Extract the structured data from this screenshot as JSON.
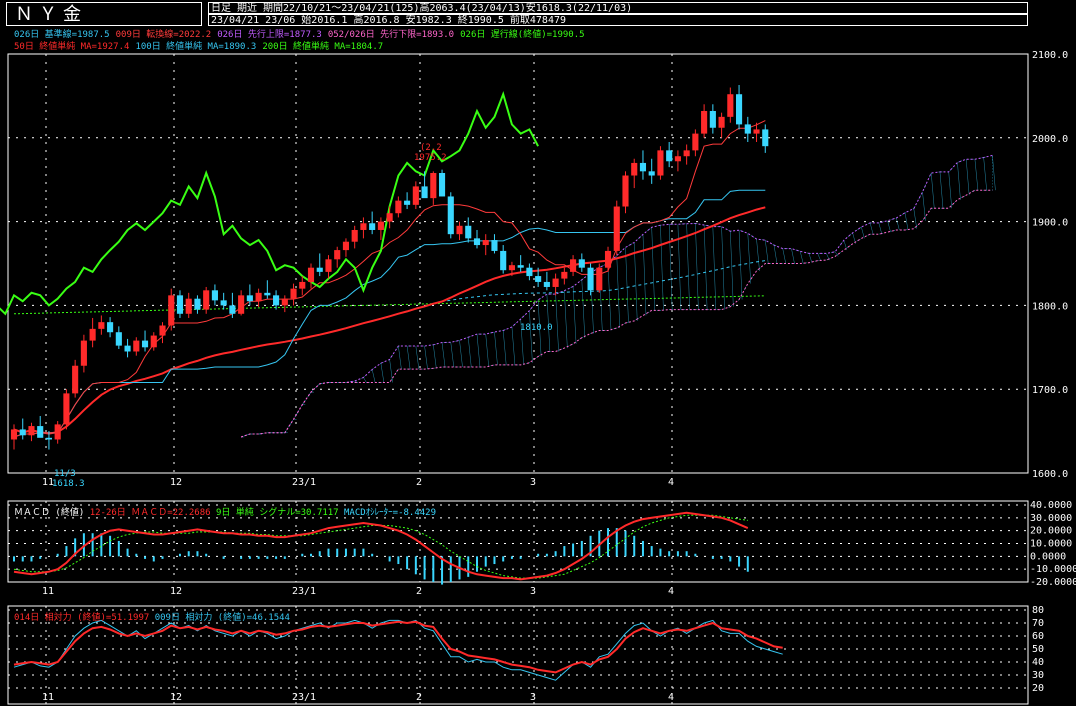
{
  "header": {
    "title": "ＮＹ金",
    "line1": "日足 期近 期間22/10/21〜23/04/21(125)高2063.4(23/04/13)安1618.3(22/11/03)",
    "line2": "23/04/21 23/06 始2016.1 高2016.8 安1982.3 終1990.5 前取478479"
  },
  "legend": {
    "row1": [
      {
        "text": "026日 基準線=1987.5",
        "color": "#36c5f0"
      },
      {
        "text": "009日 転換線=2022.2",
        "color": "#ff3b3b"
      },
      {
        "text": "026日 先行上限=1877.3",
        "color": "#c15cff"
      },
      {
        "text": "052/026日 先行下限=1893.0",
        "color": "#ff66cc"
      },
      {
        "text": "026日 遅行線(終値)=1990.5",
        "color": "#39ff14"
      }
    ],
    "row2": [
      {
        "text": "50日 終値単純 MA=1927.4",
        "color": "#ff2a2a"
      },
      {
        "text": "100日 終値単純 MA=1890.3",
        "color": "#36c5f0"
      },
      {
        "text": "200日 終値単純 MA=1804.7",
        "color": "#39ff14"
      }
    ]
  },
  "annotations": {
    "high_label": "(2.2",
    "high_value": "1975.2",
    "low_date": "11/3",
    "low_value": "1618.3",
    "mid_low": "1810.0"
  },
  "macd_legend": {
    "title": "ＭＡＣＤ (終値)",
    "macd": "12-26日 ＭＡＣＤ=22.2686",
    "signal": "9日 単純 シグナル=30.7117",
    "osc": "MACDｵｼﾚｰﾀｰ=-8.4429"
  },
  "rsi_legend": {
    "rsi14": "014日 相対力 (終値)=51.1997",
    "rsi9": "009日 相対力 (終値)=46.1544"
  },
  "colors": {
    "up_candle": "#ff2a2a",
    "down_candle": "#3ad7ff",
    "tenkan": "#ff3b3b",
    "kijun": "#36c5f0",
    "chikou": "#39ff14",
    "ma50": "#ff2a2a",
    "ma100": "#36c5f0",
    "ma200": "#39ff14",
    "span_a": "#c15cff",
    "span_b": "#ff66cc",
    "macd": "#ff2a2a",
    "signal": "#39ff14",
    "rsi14": "#ff2a2a",
    "rsi9": "#36c5f0"
  },
  "chart_data": [
    {
      "type": "candlestick",
      "title": "ＮＹ金",
      "y_ticks": [
        "2100.0",
        "2000.0",
        "1900.0",
        "1800.0",
        "1700.0",
        "1600.0"
      ],
      "ylim": [
        1600,
        2100
      ],
      "x_tick_labels": [
        "11",
        "12",
        "23/1",
        "2",
        "3",
        "4"
      ],
      "candles": [
        [
          1640,
          1658,
          1628,
          1652
        ],
        [
          1652,
          1665,
          1640,
          1645
        ],
        [
          1645,
          1660,
          1638,
          1656
        ],
        [
          1656,
          1668,
          1648,
          1642
        ],
        [
          1642,
          1650,
          1628,
          1640
        ],
        [
          1640,
          1662,
          1635,
          1658
        ],
        [
          1658,
          1700,
          1652,
          1695
        ],
        [
          1695,
          1735,
          1690,
          1728
        ],
        [
          1728,
          1765,
          1720,
          1758
        ],
        [
          1758,
          1785,
          1750,
          1772
        ],
        [
          1772,
          1788,
          1765,
          1780
        ],
        [
          1780,
          1786,
          1762,
          1768
        ],
        [
          1768,
          1775,
          1748,
          1752
        ],
        [
          1752,
          1760,
          1738,
          1745
        ],
        [
          1745,
          1762,
          1740,
          1758
        ],
        [
          1758,
          1770,
          1745,
          1750
        ],
        [
          1750,
          1768,
          1746,
          1764
        ],
        [
          1764,
          1780,
          1755,
          1776
        ],
        [
          1776,
          1820,
          1770,
          1812
        ],
        [
          1812,
          1818,
          1785,
          1790
        ],
        [
          1790,
          1815,
          1785,
          1808
        ],
        [
          1808,
          1812,
          1790,
          1795
        ],
        [
          1795,
          1822,
          1790,
          1818
        ],
        [
          1818,
          1825,
          1800,
          1806
        ],
        [
          1806,
          1815,
          1795,
          1800
        ],
        [
          1800,
          1815,
          1785,
          1790
        ],
        [
          1790,
          1818,
          1788,
          1812
        ],
        [
          1812,
          1825,
          1800,
          1805
        ],
        [
          1805,
          1820,
          1798,
          1815
        ],
        [
          1815,
          1830,
          1808,
          1812
        ],
        [
          1812,
          1818,
          1795,
          1800
        ],
        [
          1800,
          1812,
          1792,
          1808
        ],
        [
          1808,
          1826,
          1800,
          1820
        ],
        [
          1820,
          1835,
          1812,
          1828
        ],
        [
          1828,
          1850,
          1820,
          1845
        ],
        [
          1845,
          1862,
          1835,
          1840
        ],
        [
          1840,
          1860,
          1832,
          1855
        ],
        [
          1855,
          1870,
          1845,
          1866
        ],
        [
          1866,
          1880,
          1858,
          1876
        ],
        [
          1876,
          1895,
          1868,
          1890
        ],
        [
          1890,
          1905,
          1880,
          1898
        ],
        [
          1898,
          1912,
          1885,
          1890
        ],
        [
          1890,
          1905,
          1878,
          1900
        ],
        [
          1900,
          1918,
          1892,
          1910
        ],
        [
          1910,
          1930,
          1905,
          1925
        ],
        [
          1925,
          1935,
          1915,
          1920
        ],
        [
          1920,
          1948,
          1915,
          1942
        ],
        [
          1942,
          1960,
          1930,
          1928
        ],
        [
          1928,
          1960,
          1920,
          1958
        ],
        [
          1958,
          1962,
          1930,
          1930
        ],
        [
          1930,
          1935,
          1880,
          1885
        ],
        [
          1885,
          1900,
          1878,
          1895
        ],
        [
          1895,
          1905,
          1875,
          1880
        ],
        [
          1880,
          1890,
          1868,
          1872
        ],
        [
          1872,
          1885,
          1860,
          1878
        ],
        [
          1878,
          1885,
          1862,
          1865
        ],
        [
          1865,
          1872,
          1838,
          1842
        ],
        [
          1842,
          1852,
          1835,
          1848
        ],
        [
          1848,
          1860,
          1840,
          1845
        ],
        [
          1845,
          1850,
          1830,
          1835
        ],
        [
          1835,
          1845,
          1822,
          1828
        ],
        [
          1828,
          1840,
          1818,
          1822
        ],
        [
          1822,
          1838,
          1812,
          1832
        ],
        [
          1832,
          1845,
          1825,
          1840
        ],
        [
          1840,
          1860,
          1835,
          1855
        ],
        [
          1855,
          1862,
          1840,
          1845
        ],
        [
          1845,
          1850,
          1812,
          1818
        ],
        [
          1818,
          1850,
          1815,
          1845
        ],
        [
          1845,
          1870,
          1840,
          1865
        ],
        [
          1865,
          1925,
          1860,
          1918
        ],
        [
          1918,
          1960,
          1910,
          1955
        ],
        [
          1955,
          1975,
          1940,
          1970
        ],
        [
          1970,
          1985,
          1950,
          1960
        ],
        [
          1960,
          1975,
          1945,
          1955
        ],
        [
          1955,
          1990,
          1950,
          1985
        ],
        [
          1985,
          1995,
          1965,
          1972
        ],
        [
          1972,
          1985,
          1960,
          1978
        ],
        [
          1978,
          1992,
          1968,
          1985
        ],
        [
          1985,
          2010,
          1978,
          2005
        ],
        [
          2005,
          2040,
          2000,
          2032
        ],
        [
          2032,
          2040,
          2005,
          2012
        ],
        [
          2012,
          2030,
          2000,
          2025
        ],
        [
          2025,
          2060,
          2018,
          2052
        ],
        [
          2052,
          2063,
          2010,
          2016
        ],
        [
          2016,
          2025,
          1995,
          2005
        ],
        [
          2005,
          2018,
          1995,
          2010
        ],
        [
          2010,
          2016,
          1982,
          1990
        ]
      ]
    },
    {
      "type": "line",
      "title": "ＭＡＣＤ (終値)",
      "y_ticks": [
        "40.0000",
        "30.0000",
        "20.0000",
        "10.0000",
        "0.0000",
        "-10.0000",
        "-20.0000"
      ],
      "ylim": [
        -20,
        40
      ],
      "series": [
        {
          "name": "12-26日 ＭＡＣＤ",
          "values": [
            -12,
            -13,
            -14,
            -13,
            -12,
            -10,
            -5,
            2,
            8,
            13,
            17,
            20,
            21,
            20,
            19,
            18,
            17,
            17,
            18,
            19,
            20,
            21,
            20,
            19,
            18,
            18,
            17,
            17,
            16,
            16,
            15,
            15,
            16,
            17,
            18,
            20,
            22,
            23,
            24,
            25,
            26,
            25,
            24,
            22,
            20,
            17,
            13,
            8,
            3,
            -2,
            -6,
            -9,
            -12,
            -14,
            -15,
            -16,
            -17,
            -17,
            -18,
            -17,
            -16,
            -15,
            -13,
            -10,
            -6,
            -2,
            3,
            9,
            15,
            20,
            24,
            27,
            29,
            30,
            31,
            32,
            33,
            34,
            33,
            32,
            31,
            30,
            28,
            25,
            22
          ]
        },
        {
          "name": "9日 単純 シグナル",
          "values": [
            -10,
            -11,
            -12,
            -12,
            -12,
            -11,
            -9,
            -5,
            -1,
            4,
            8,
            12,
            15,
            17,
            18,
            19,
            19,
            18,
            18,
            18,
            18,
            19,
            19,
            19,
            19,
            18,
            18,
            18,
            17,
            17,
            16,
            16,
            16,
            16,
            17,
            18,
            19,
            20,
            21,
            22,
            23,
            24,
            24,
            24,
            23,
            22,
            20,
            17,
            13,
            9,
            4,
            0,
            -4,
            -8,
            -11,
            -13,
            -15,
            -16,
            -17,
            -17,
            -17,
            -16,
            -15,
            -14,
            -11,
            -8,
            -5,
            -1,
            4,
            9,
            14,
            19,
            23,
            26,
            28,
            30,
            31,
            32,
            32,
            32,
            32,
            31,
            30,
            29,
            28
          ]
        }
      ]
    },
    {
      "type": "line",
      "title": "相対力",
      "y_ticks": [
        "80",
        "70",
        "60",
        "50",
        "40",
        "30",
        "20"
      ],
      "ylim": [
        20,
        80
      ],
      "series": [
        {
          "name": "014日 相対力 (終値)",
          "values": [
            38,
            39,
            40,
            39,
            38,
            40,
            48,
            56,
            62,
            66,
            67,
            65,
            62,
            60,
            62,
            60,
            62,
            64,
            68,
            66,
            67,
            65,
            67,
            65,
            64,
            62,
            64,
            62,
            64,
            63,
            61,
            62,
            64,
            65,
            67,
            68,
            67,
            68,
            69,
            70,
            70,
            68,
            69,
            70,
            71,
            70,
            71,
            68,
            67,
            58,
            50,
            48,
            45,
            44,
            43,
            42,
            40,
            38,
            37,
            36,
            34,
            33,
            32,
            35,
            38,
            40,
            38,
            42,
            44,
            50,
            58,
            63,
            66,
            64,
            62,
            64,
            65,
            64,
            66,
            68,
            70,
            66,
            65,
            64,
            60,
            58,
            55,
            52,
            51
          ]
        },
        {
          "name": "009日 相対力 (終値)",
          "values": [
            36,
            38,
            40,
            37,
            36,
            40,
            50,
            60,
            66,
            70,
            72,
            68,
            64,
            60,
            64,
            58,
            62,
            66,
            70,
            66,
            68,
            64,
            68,
            64,
            62,
            60,
            64,
            60,
            64,
            62,
            58,
            60,
            64,
            66,
            68,
            70,
            66,
            70,
            70,
            72,
            70,
            66,
            70,
            72,
            72,
            70,
            72,
            66,
            64,
            54,
            44,
            44,
            40,
            42,
            40,
            40,
            36,
            34,
            34,
            32,
            30,
            28,
            26,
            32,
            38,
            40,
            36,
            44,
            46,
            54,
            62,
            68,
            70,
            64,
            60,
            64,
            66,
            62,
            66,
            70,
            72,
            64,
            62,
            62,
            56,
            52,
            50,
            48,
            46
          ]
        }
      ]
    }
  ]
}
